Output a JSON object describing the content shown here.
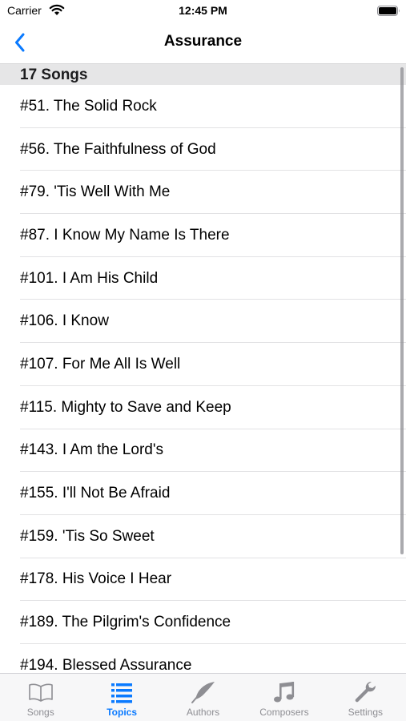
{
  "status_bar": {
    "carrier": "Carrier",
    "time": "12:45 PM"
  },
  "nav": {
    "title": "Assurance",
    "back_icon": "chevron-left-icon",
    "accent_color": "#0a7aff"
  },
  "section": {
    "header": "17 Songs"
  },
  "songs": [
    "#51. The Solid Rock",
    "#56. The Faithfulness of God",
    "#79. 'Tis Well With Me",
    "#87. I Know My Name Is There",
    "#101. I Am His Child",
    "#106. I Know",
    "#107. For Me All Is Well",
    "#115. Mighty to Save and Keep",
    "#143. I Am the Lord's",
    "#155. I'll Not Be Afraid",
    "#159. 'Tis So Sweet",
    "#178. His Voice I Hear",
    "#189. The Pilgrim's Confidence",
    "#194. Blessed Assurance"
  ],
  "tabs": [
    {
      "label": "Songs",
      "icon": "book-icon",
      "active": false
    },
    {
      "label": "Topics",
      "icon": "list-icon",
      "active": true
    },
    {
      "label": "Authors",
      "icon": "quill-icon",
      "active": false
    },
    {
      "label": "Composers",
      "icon": "music-note-icon",
      "active": false
    },
    {
      "label": "Settings",
      "icon": "wrench-icon",
      "active": false
    }
  ]
}
